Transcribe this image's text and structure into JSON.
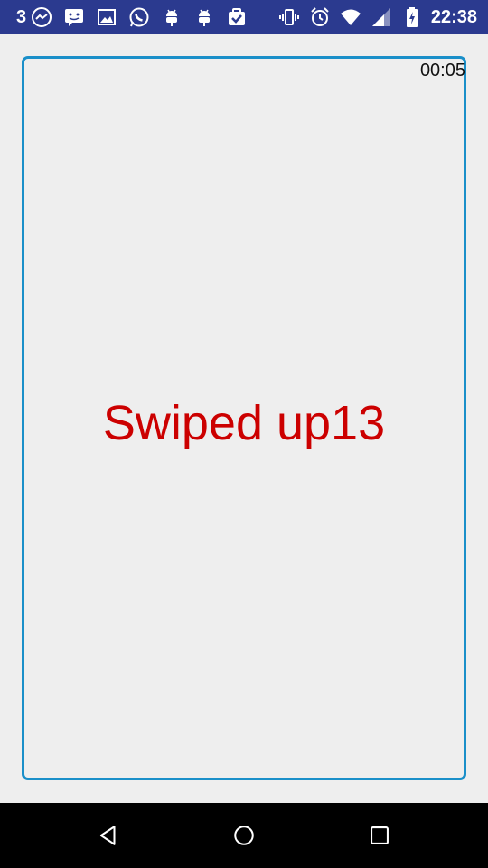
{
  "status_bar": {
    "notification_count": "3",
    "icons_left": [
      "messenger-icon",
      "message-icon",
      "image-icon",
      "whatsapp-icon",
      "android-icon",
      "android-icon",
      "task-check-icon"
    ],
    "icons_right": [
      "vibrate-icon",
      "alarm-icon",
      "wifi-icon",
      "signal-icon",
      "battery-charging-icon"
    ],
    "time": "22:38",
    "background_color": "#2b3a8f"
  },
  "card": {
    "timer": "00:05",
    "swipe_text": "Swiped up13",
    "swipe_text_color": "#cc0000",
    "border_color": "#1a8fc9"
  },
  "nav_bar": {
    "buttons": [
      "back-icon",
      "home-icon",
      "recents-icon"
    ]
  }
}
